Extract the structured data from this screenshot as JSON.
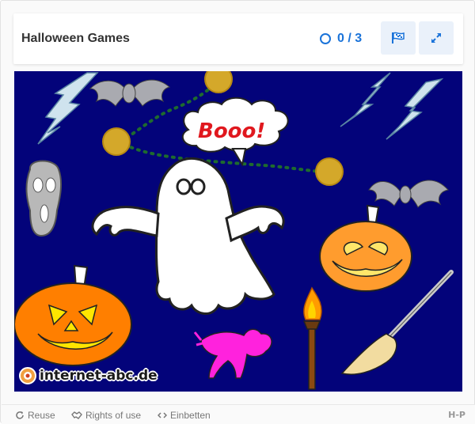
{
  "header": {
    "title": "Halloween Games",
    "score": "0 / 3"
  },
  "scene": {
    "speech_bubble": "Booo!",
    "logo_text": "internet-abc.de",
    "colors": {
      "background": "#03037a",
      "hotspot": "#d4a82a",
      "path_dots": "#1e6b2e"
    }
  },
  "footer": {
    "reuse": "Reuse",
    "rights": "Rights of use",
    "embed": "Einbetten",
    "brand": "H-P"
  }
}
